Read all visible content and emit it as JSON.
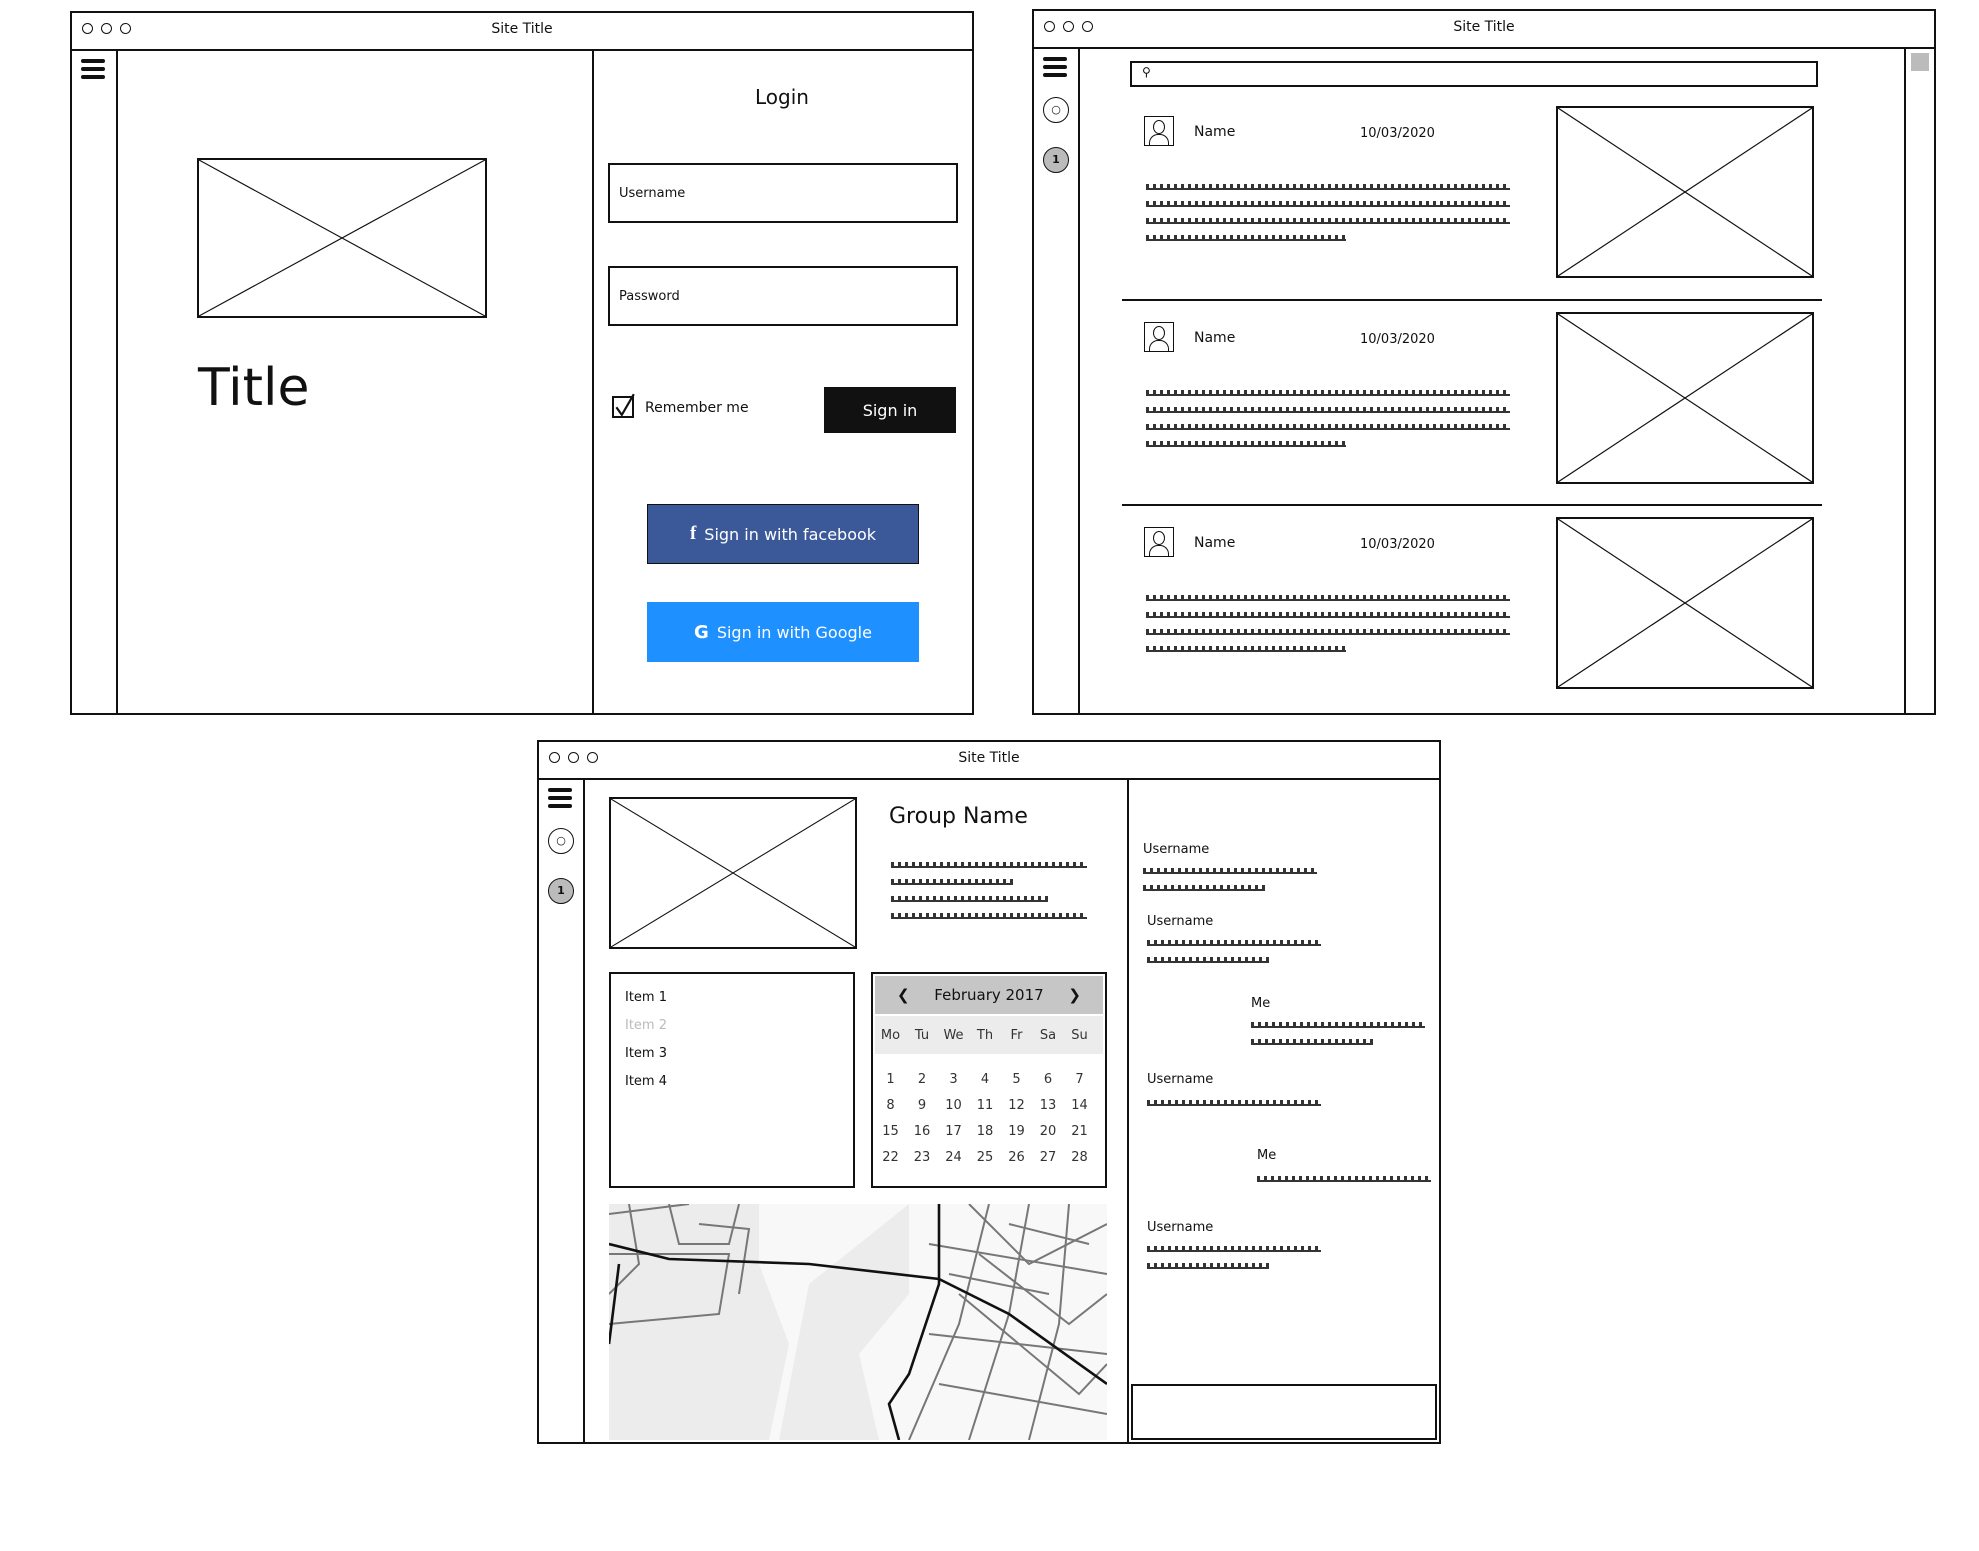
{
  "login_window": {
    "site_title": "Site Title",
    "hero_title": "Title",
    "login_heading": "Login",
    "username_placeholder": "Username",
    "password_placeholder": "Password",
    "remember_label": "Remember me",
    "sign_in_label": "Sign in",
    "facebook_label": "Sign in with facebook",
    "google_label": "Sign in with Google",
    "facebook_color": "#3b5998",
    "google_color": "#1e90ff"
  },
  "feed_window": {
    "site_title": "Site Title",
    "badge": "1",
    "posts": [
      {
        "name": "Name",
        "date": "10/03/2020"
      },
      {
        "name": "Name",
        "date": "10/03/2020"
      },
      {
        "name": "Name",
        "date": "10/03/2020"
      }
    ]
  },
  "group_window": {
    "site_title": "Site Title",
    "badge": "1",
    "group_name": "Group Name",
    "list_items": [
      "Item 1",
      "Item 2",
      "Item 3",
      "Item 4"
    ],
    "calendar": {
      "month": "February 2017",
      "prev": "❮",
      "next": "❯",
      "weekdays": [
        "Mo",
        "Tu",
        "We",
        "Th",
        "Fr",
        "Sa",
        "Su"
      ],
      "weeks": [
        [
          "1",
          "2",
          "3",
          "4",
          "5",
          "6",
          "7"
        ],
        [
          "8",
          "9",
          "10",
          "11",
          "12",
          "13",
          "14"
        ],
        [
          "15",
          "16",
          "17",
          "18",
          "19",
          "20",
          "21"
        ],
        [
          "22",
          "23",
          "24",
          "25",
          "26",
          "27",
          "28"
        ]
      ]
    },
    "chat": [
      {
        "author": "Username"
      },
      {
        "author": "Username"
      },
      {
        "author": "Me"
      },
      {
        "author": "Username"
      },
      {
        "author": "Me"
      },
      {
        "author": "Username"
      }
    ]
  }
}
